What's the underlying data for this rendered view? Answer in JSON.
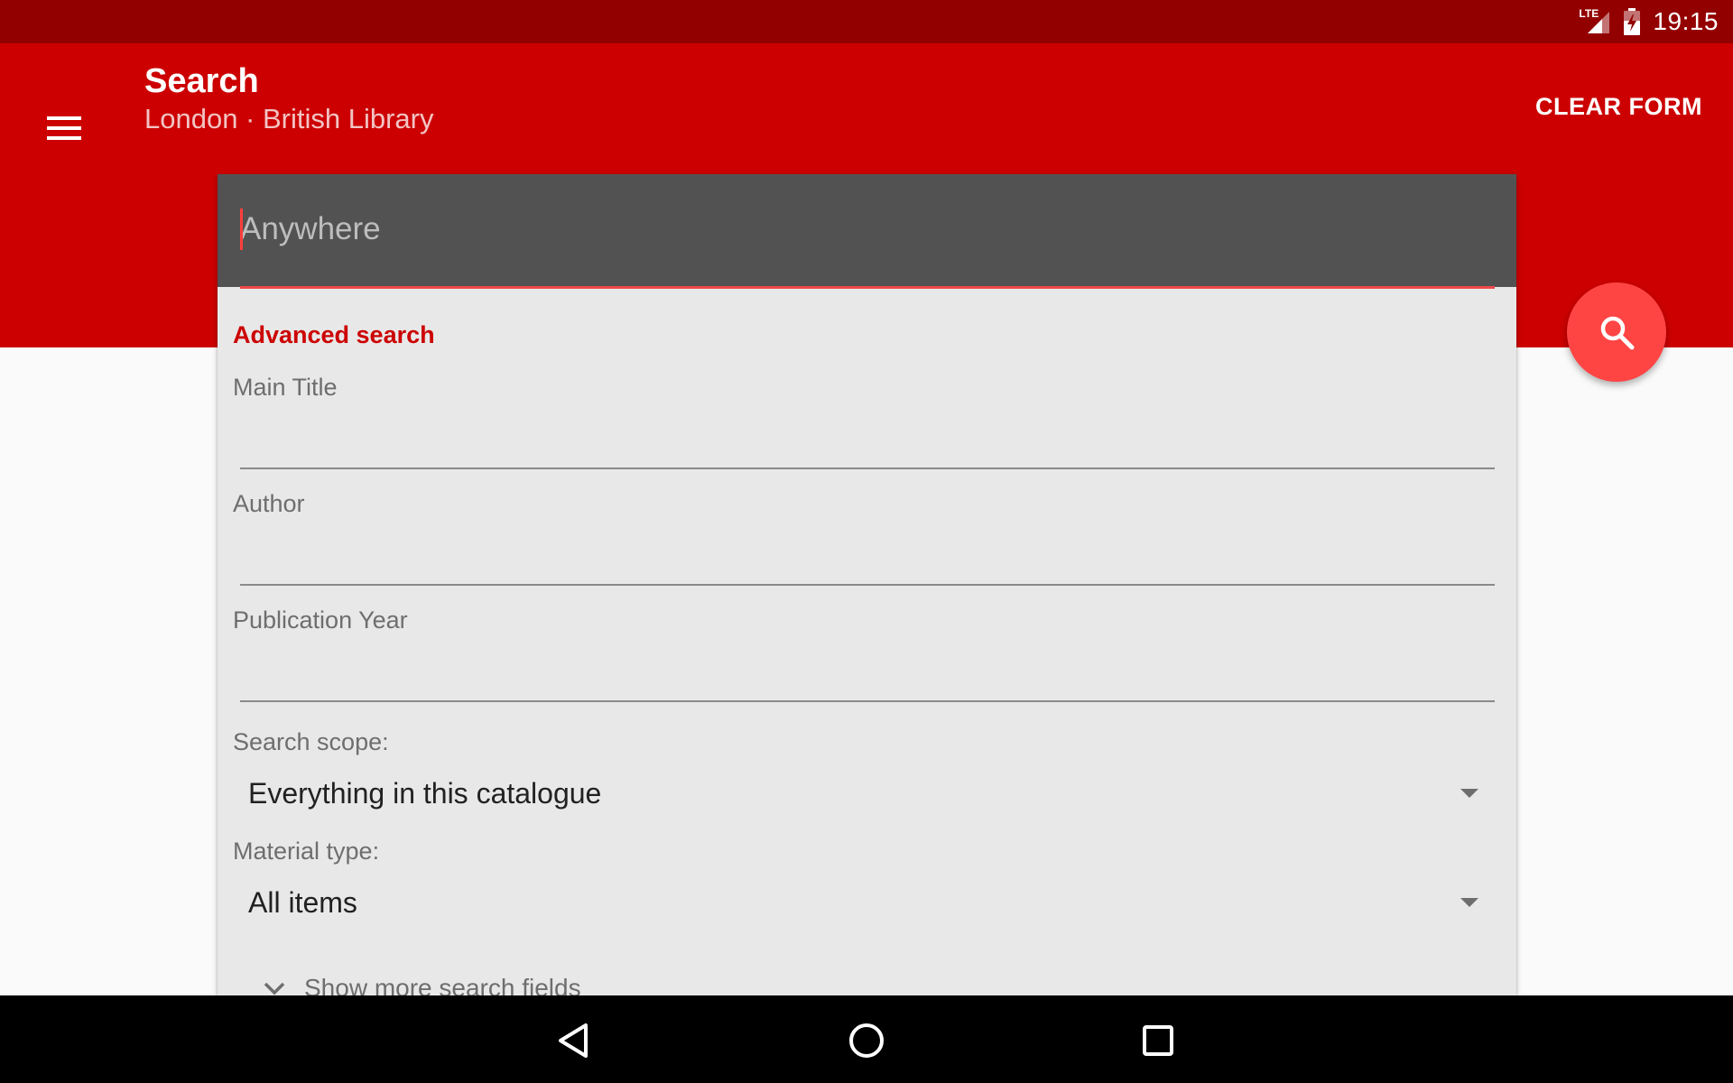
{
  "status_bar": {
    "network_label": "LTE",
    "time": "19:15",
    "icons": [
      "lte-signal-icon",
      "battery-charging-icon"
    ]
  },
  "toolbar": {
    "menu_icon": "hamburger-menu-icon",
    "title": "Search",
    "subtitle": "London · British Library",
    "clear_label": "CLEAR FORM"
  },
  "search": {
    "anywhere_placeholder": "Anywhere",
    "anywhere_value": ""
  },
  "advanced": {
    "heading": "Advanced search",
    "fields": [
      {
        "label": "Main Title",
        "value": ""
      },
      {
        "label": "Author",
        "value": ""
      },
      {
        "label": "Publication Year",
        "value": ""
      }
    ],
    "scope": {
      "label": "Search scope:",
      "selected": "Everything in this catalogue"
    },
    "material": {
      "label": "Material type:",
      "selected": "All items"
    },
    "more_label": "Show more search fields"
  },
  "fab": {
    "icon": "search-icon"
  },
  "nav": {
    "icons": [
      "back-icon",
      "home-icon",
      "recents-icon"
    ]
  },
  "colors": {
    "status_bar": "#930000",
    "primary": "#cc0000",
    "accent": "#ff4444",
    "card": "#e8e8e8",
    "search_box": "#525252"
  }
}
